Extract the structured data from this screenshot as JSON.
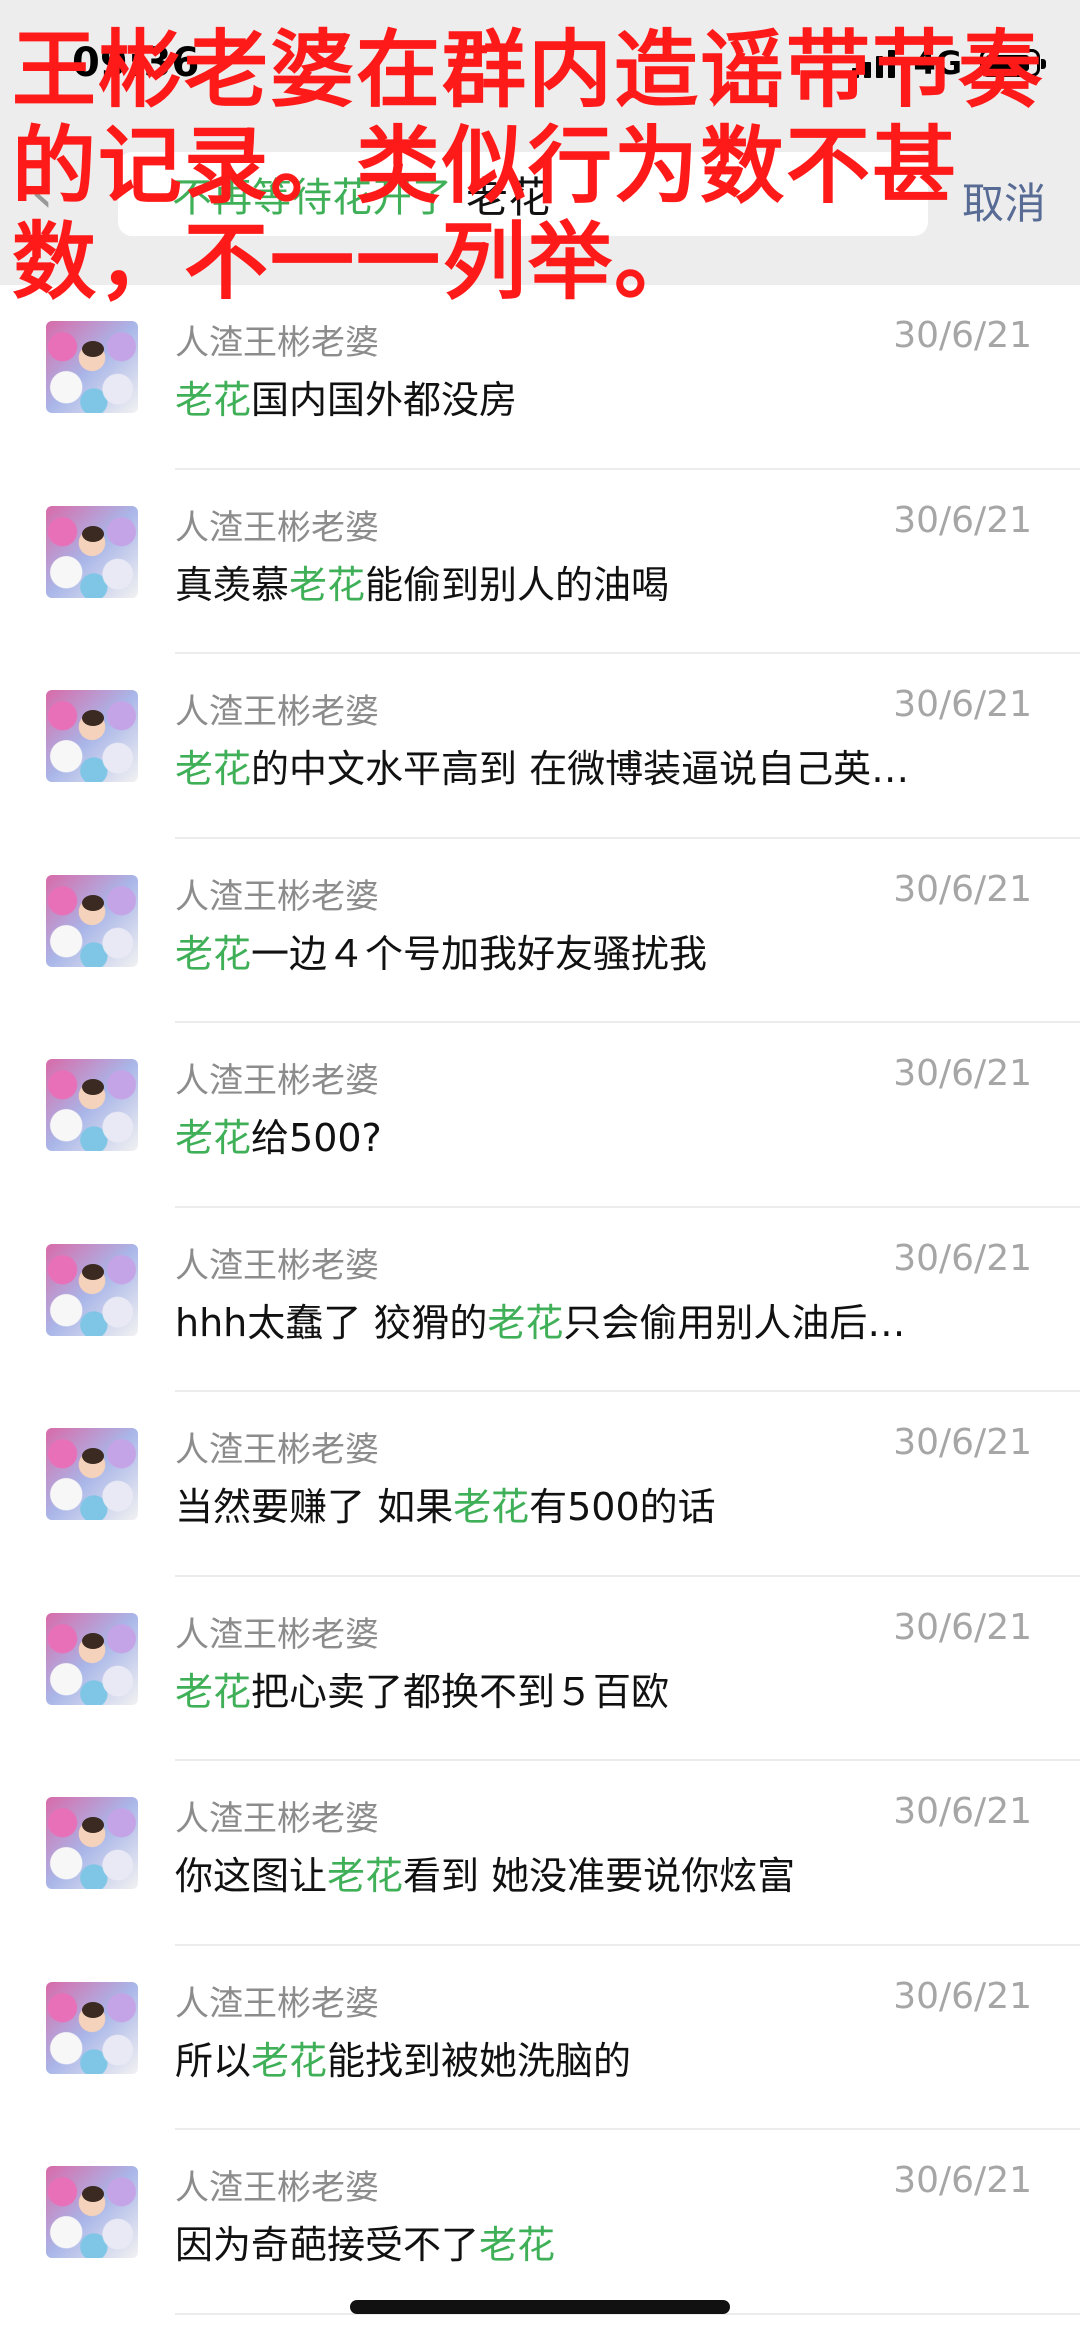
{
  "caption": "王彬老婆在群内造谣带节奏的记录。类似行为数不甚数，不一一列举。",
  "status": {
    "time": "09:36",
    "network": "4G"
  },
  "search": {
    "back_icon": "chevron-left-icon",
    "chip": "不再等待花开了",
    "query": "老花",
    "cancel_label": "取消"
  },
  "results": [
    {
      "sender": "人渣王彬老婆",
      "date": "30/6/21",
      "pre": "",
      "hl": "老花",
      "post": "国内国外都没房"
    },
    {
      "sender": "人渣王彬老婆",
      "date": "30/6/21",
      "pre": "真羡慕",
      "hl": "老花",
      "post": "能偷到别人的油喝"
    },
    {
      "sender": "人渣王彬老婆",
      "date": "30/6/21",
      "pre": "",
      "hl": "老花",
      "post": "的中文水平高到 在微博装逼说自己英…"
    },
    {
      "sender": "人渣王彬老婆",
      "date": "30/6/21",
      "pre": "",
      "hl": "老花",
      "post": "一边４个号加我好友骚扰我"
    },
    {
      "sender": "人渣王彬老婆",
      "date": "30/6/21",
      "pre": "",
      "hl": "老花",
      "post": "给500?"
    },
    {
      "sender": "人渣王彬老婆",
      "date": "30/6/21",
      "pre": "hhh太蠢了 狡猾的",
      "hl": "老花",
      "post": "只会偷用别人油后…"
    },
    {
      "sender": "人渣王彬老婆",
      "date": "30/6/21",
      "pre": "当然要赚了 如果",
      "hl": "老花",
      "post": "有500的话"
    },
    {
      "sender": "人渣王彬老婆",
      "date": "30/6/21",
      "pre": "",
      "hl": "老花",
      "post": "把心卖了都换不到５百欧"
    },
    {
      "sender": "人渣王彬老婆",
      "date": "30/6/21",
      "pre": "你这图让",
      "hl": "老花",
      "post": "看到 她没准要说你炫富"
    },
    {
      "sender": "人渣王彬老婆",
      "date": "30/6/21",
      "pre": "所以",
      "hl": "老花",
      "post": "能找到被她洗脑的"
    },
    {
      "sender": "人渣王彬老婆",
      "date": "30/6/21",
      "pre": "因为奇葩接受不了",
      "hl": "老花",
      "post": ""
    }
  ]
}
